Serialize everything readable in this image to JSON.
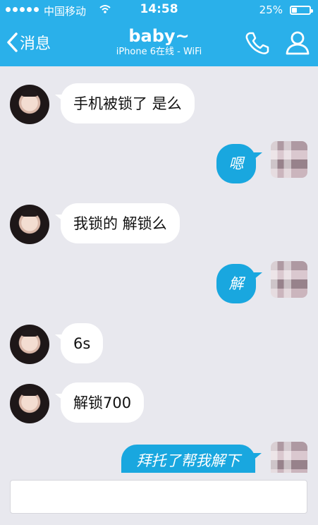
{
  "status_bar": {
    "carrier": "中国移动",
    "wifi_icon": "wifi-icon",
    "time": "14:58",
    "battery_percent": "25%",
    "battery_level": 0.25
  },
  "nav": {
    "back_label": "消息",
    "title": "baby~",
    "subtitle": "iPhone 6在线 - WiFi",
    "phone_icon": "phone-icon",
    "profile_icon": "profile-icon"
  },
  "colors": {
    "accent": "#2ab0ea",
    "outgoing_bubble": "#19a7df",
    "incoming_bubble": "#ffffff",
    "background": "#e8e8ee"
  },
  "messages": [
    {
      "side": "left",
      "text": "手机被锁了 是么"
    },
    {
      "side": "right",
      "text": "嗯"
    },
    {
      "side": "left",
      "text": "我锁的 解锁么"
    },
    {
      "side": "right",
      "text": "解"
    },
    {
      "side": "left",
      "text": "6s"
    },
    {
      "side": "left",
      "text": "解锁700"
    },
    {
      "side": "right",
      "text": "拜托了帮我解下"
    }
  ],
  "input": {
    "value": "",
    "placeholder": ""
  }
}
